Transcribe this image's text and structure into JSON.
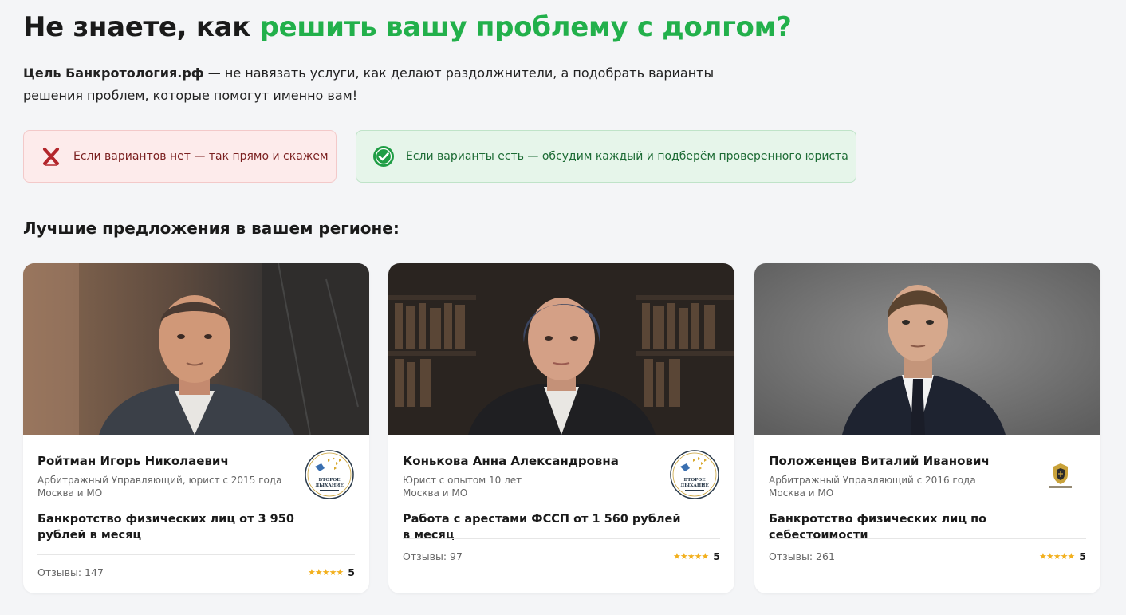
{
  "header": {
    "title_plain": "Не знаете, как ",
    "title_accent": "решить вашу проблему с долгом?",
    "lead_bold": "Цель Банкротология.рф",
    "lead_text": " — не навязать услуги, как делают раздолжнители, а подобрать варианты решения проблем, которые помогут именно вам!"
  },
  "notes": {
    "negative": {
      "text": "Если вариантов нет — так прямо и скажем",
      "icon": "cross-icon"
    },
    "positive": {
      "text": "Если варианты есть — обсудим каждый и подберём проверенного юриста",
      "icon": "check-icon"
    }
  },
  "section_title": "Лучшие предложения в вашем регионе:",
  "cards": [
    {
      "name": "Ройтман Игорь Николаевич",
      "role": "Арбитражный Управляющий, юрист с 2015 года",
      "city": "Москва и МО",
      "offer": "Банкротство физических лиц от 3 950 рублей в месяц",
      "reviews": "Отзывы: 147",
      "stars": "★★★★★",
      "score": "5",
      "logo_text": "ВТОРОЕ ДЫХАНИЕ"
    },
    {
      "name": "Конькова Анна Александровна",
      "role": "Юрист с опытом 10 лет",
      "city": "Москва и МО",
      "offer": "Работа с арестами ФССП от 1 560 рублей в месяц",
      "reviews": "Отзывы: 97",
      "stars": "★★★★★",
      "score": "5",
      "logo_text": "ВТОРОЕ ДЫХАНИЕ"
    },
    {
      "name": "Положенцев Виталий Иванович",
      "role": "Арбитражный Управляющий с 2016 года",
      "city": "Москва и МО",
      "offer": "Банкротство физических лиц по себестоимости",
      "reviews": "Отзывы: 261",
      "stars": "★★★★★",
      "score": "5",
      "logo_text": ""
    }
  ],
  "colors": {
    "accent_green": "#22b04b",
    "star_gold": "#f2b01e",
    "negative_bg": "#fdebeb",
    "positive_bg": "#e6f5ea"
  }
}
